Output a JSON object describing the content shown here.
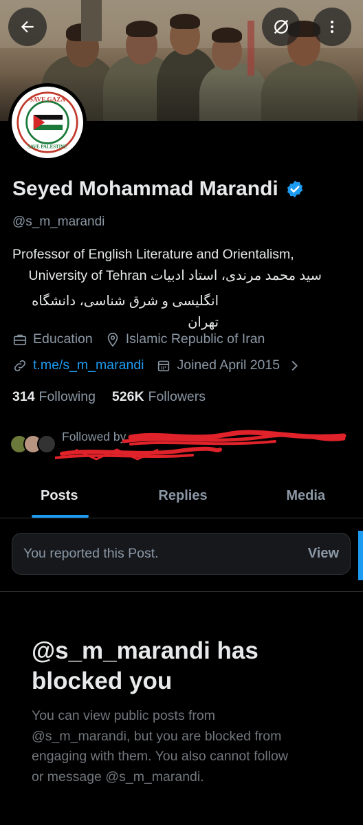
{
  "profile": {
    "name": "Seyed Mohammad Marandi",
    "handle": "@s_m_marandi",
    "bio_line1": "Professor of English Literature and Orientalism,",
    "bio_line2": "University of Tehran سید محمد مرندی، استاد ادبیات",
    "bio_line3": "انگلیسی و شرق شناسی، دانشگاه تهران",
    "category": "Education",
    "location": "Islamic Republic of Iran",
    "website": "t.me/s_m_marandi",
    "joined": "Joined April 2015",
    "following_count": "314",
    "following_label": "Following",
    "followers_count": "526K",
    "followers_label": "Followers",
    "followed_by": "Followed by"
  },
  "avatar": {
    "top_text": "SAVE GAZA",
    "bottom_text": "SAVE PALESTINE"
  },
  "tabs": [
    {
      "label": "Posts",
      "active": true
    },
    {
      "label": "Replies",
      "active": false
    },
    {
      "label": "Media",
      "active": false
    }
  ],
  "report": {
    "text": "You reported this Post.",
    "action": "View"
  },
  "blocked": {
    "title": "@s_m_marandi has blocked you",
    "description": "You can view public posts from @s_m_marandi, but you are blocked from engaging with them. You also cannot follow or message @s_m_marandi."
  },
  "icons": {
    "back": "back-arrow-icon",
    "no_translate": "no-translate-icon",
    "more": "more-vertical-icon",
    "verified": "verified-badge-icon",
    "category": "briefcase-icon",
    "location": "location-pin-icon",
    "link": "link-icon",
    "calendar": "calendar-icon",
    "chevron": "chevron-right-icon"
  },
  "colors": {
    "accent": "#1d9bf0",
    "background": "#000000",
    "text_primary": "#e7e9ea",
    "text_secondary": "#8b98a5",
    "redaction": "#e0222a"
  }
}
